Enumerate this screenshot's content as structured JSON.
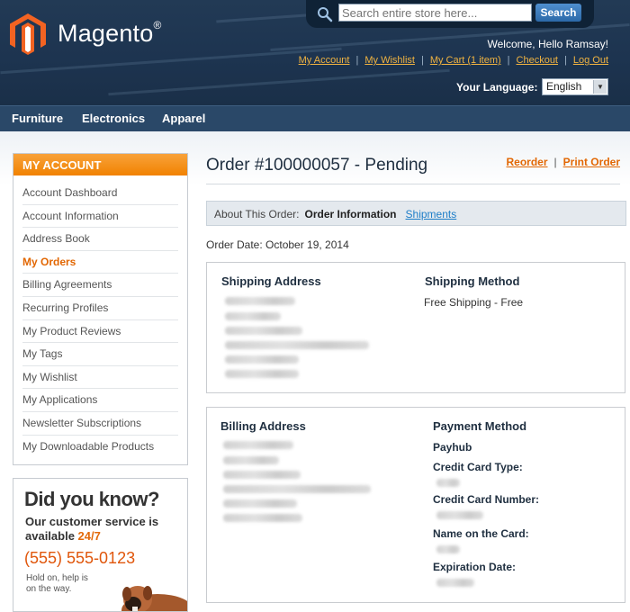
{
  "header": {
    "logo_text": "Magento",
    "logo_mark": "®",
    "search": {
      "placeholder": "Search entire store here...",
      "button": "Search"
    },
    "welcome": "Welcome, Hello Ramsay!",
    "links": [
      "My Account",
      "My Wishlist",
      "My Cart (1 item)",
      "Checkout",
      "Log Out"
    ],
    "language_label": "Your Language:",
    "language_value": "English"
  },
  "nav": {
    "items": [
      "Furniture",
      "Electronics",
      "Apparel"
    ]
  },
  "sidebar": {
    "title": "MY ACCOUNT",
    "items": [
      "Account Dashboard",
      "Account Information",
      "Address Book",
      "My Orders",
      "Billing Agreements",
      "Recurring Profiles",
      "My Product Reviews",
      "My Tags",
      "My Wishlist",
      "My Applications",
      "Newsletter Subscriptions",
      "My Downloadable Products"
    ],
    "active_index": 3
  },
  "promo": {
    "title": "Did you know?",
    "line1": "Our customer service is",
    "line2_prefix": "available ",
    "line2_highlight": "24/7",
    "phone": "(555) 555-0123",
    "small1": "Hold on, help is",
    "small2": "on the way."
  },
  "order": {
    "title": "Order #100000057 - Pending",
    "actions": [
      "Reorder",
      "Print Order"
    ],
    "tabs_label": "About This Order:",
    "tab_current": "Order Information",
    "tab_link": "Shipments",
    "date": "Order Date: October 19, 2014",
    "shipping_address_title": "Shipping Address",
    "shipping_method_title": "Shipping Method",
    "shipping_method": "Free Shipping - Free",
    "billing_address_title": "Billing Address",
    "payment_method_title": "Payment Method",
    "payment_name": "Payhub",
    "cc_type_label": "Credit Card Type:",
    "cc_number_label": "Credit Card Number:",
    "card_name_label": "Name on the Card:",
    "expiration_label": "Expiration Date:"
  },
  "colors": {
    "header_bg": "#1d3450",
    "nav_bg": "#2a4868",
    "accent_orange": "#f18200",
    "link_blue": "#1e7ec8",
    "toplink_gold": "#f0b341"
  }
}
